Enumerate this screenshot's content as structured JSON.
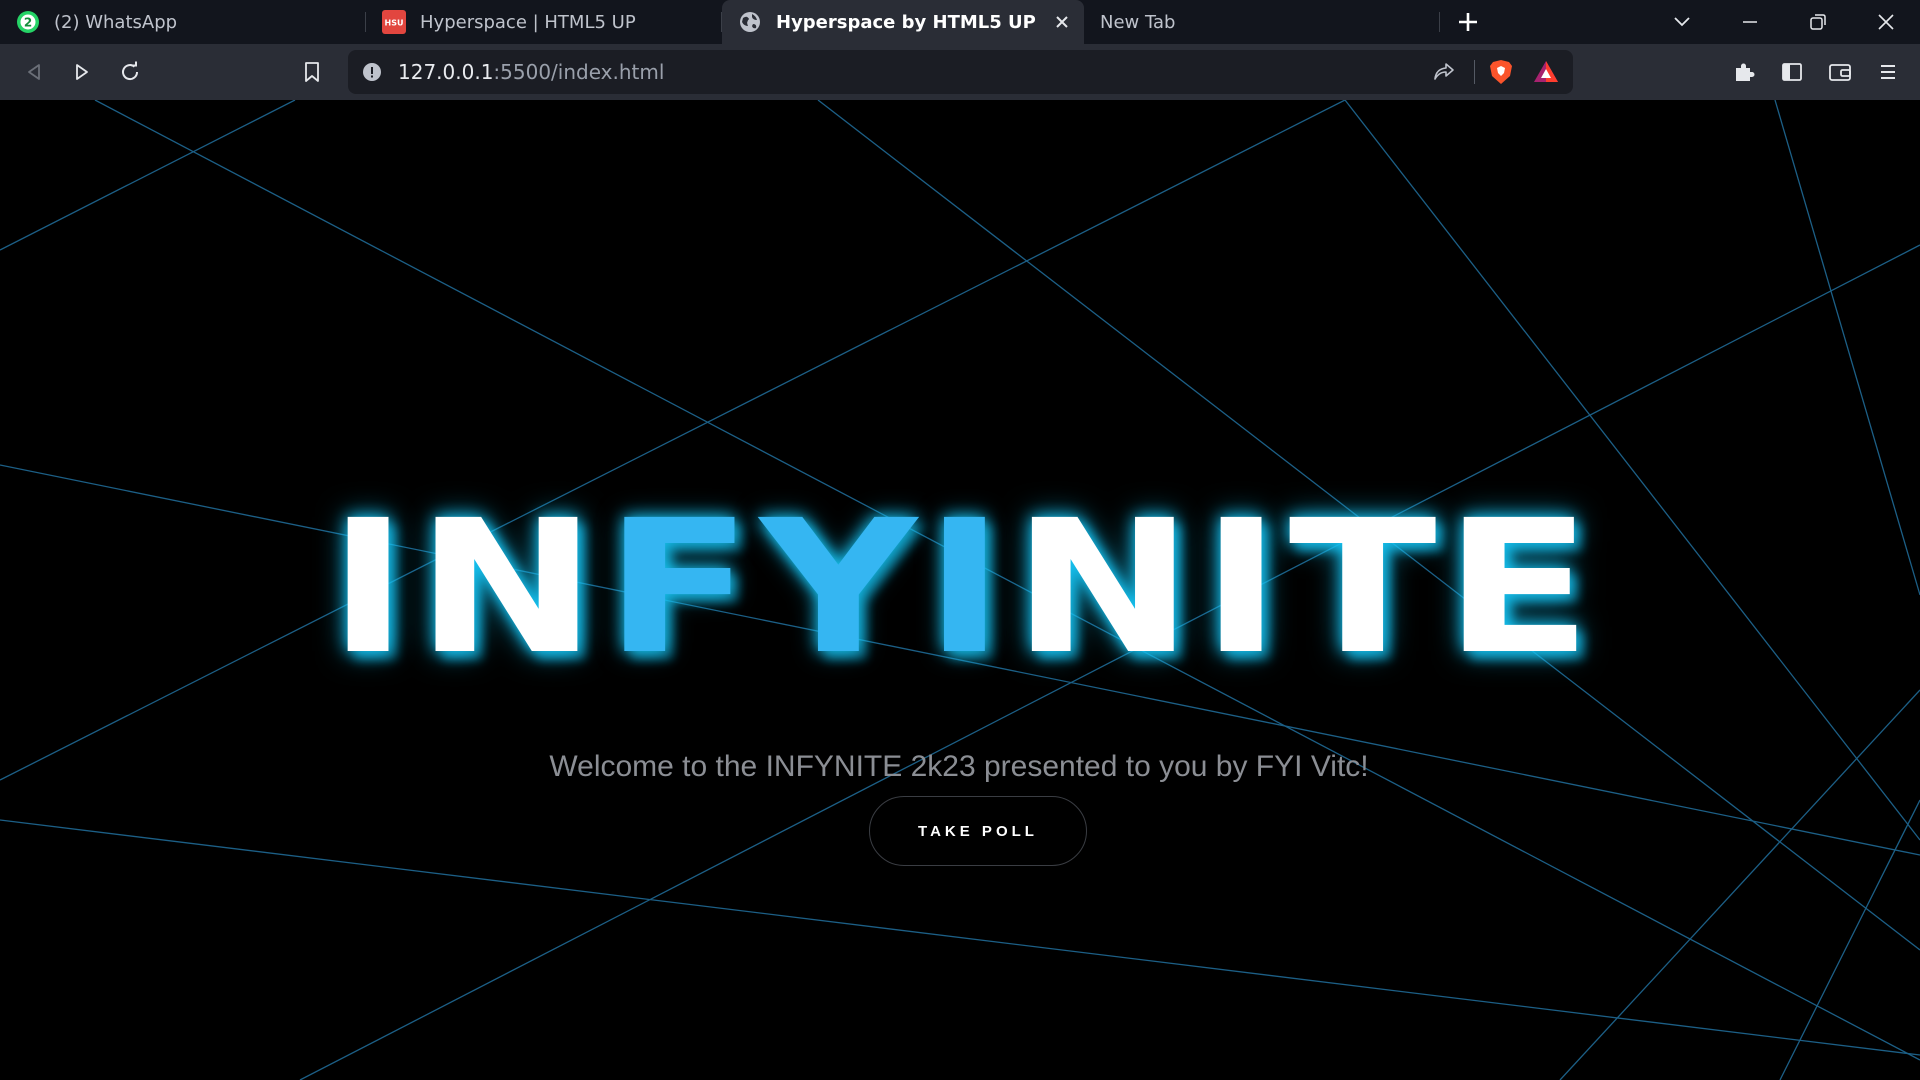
{
  "tabs": [
    {
      "title": "(2) WhatsApp",
      "badge": "2",
      "icon": "whatsapp-icon",
      "active": false
    },
    {
      "title": "Hyperspace | HTML5 UP",
      "icon_text": "HSU",
      "icon": "html5up-icon",
      "active": false
    },
    {
      "title": "Hyperspace by HTML5 UP",
      "icon": "globe-icon",
      "active": true
    },
    {
      "title": "New Tab",
      "active": false
    }
  ],
  "address_bar": {
    "host": "127.0.0.1",
    "path": ":5500/index.html"
  },
  "page": {
    "logo_parts": [
      {
        "text": "IN",
        "color": "#ffffff"
      },
      {
        "text": "FYI",
        "color": "#35b6f2"
      },
      {
        "text": "NITE",
        "color": "#ffffff"
      }
    ],
    "welcome_text": "Welcome to the INFYNITE 2k23 presented to you by FYI Vitc!",
    "poll_button": "TAKE POLL"
  },
  "colors": {
    "accent_blue": "#35b6f2",
    "glow": "#16c3f2",
    "line": "#1c5f86",
    "background": "#000000"
  }
}
